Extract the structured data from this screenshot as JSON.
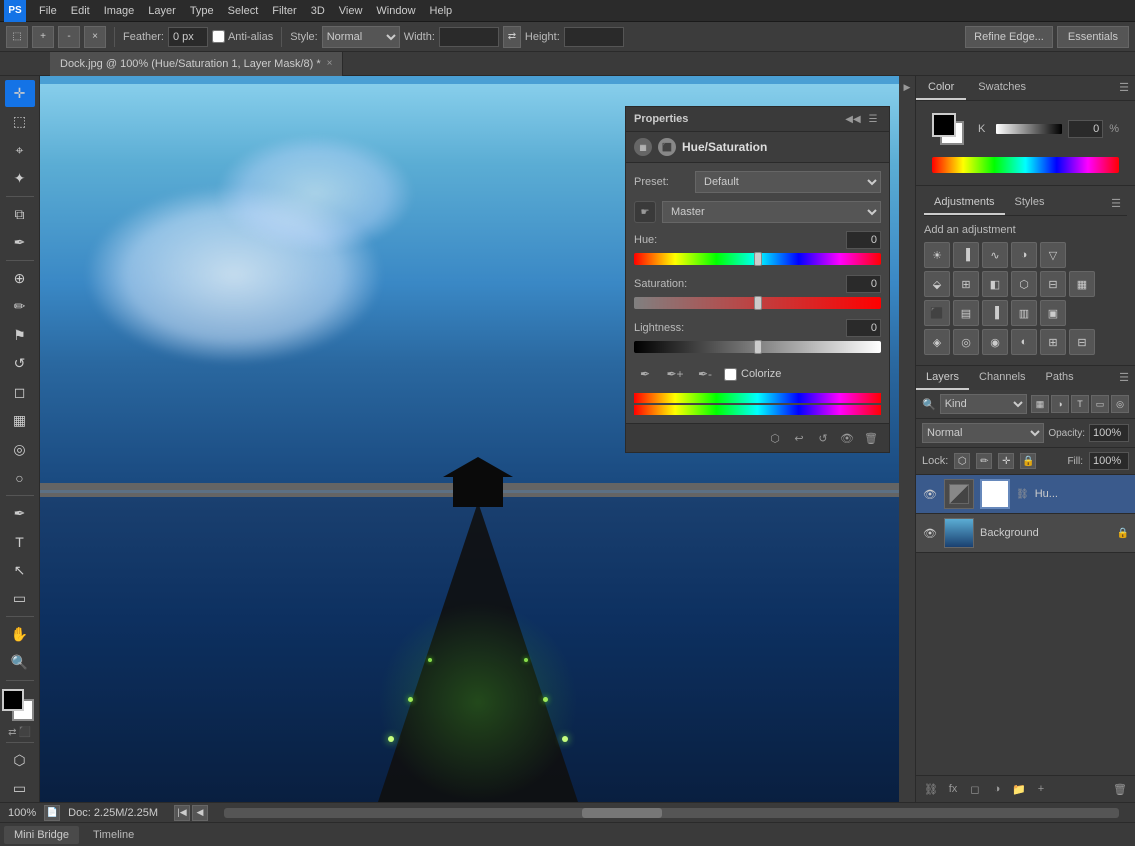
{
  "app": {
    "name": "Adobe Photoshop",
    "logo": "PS"
  },
  "menu": {
    "items": [
      "File",
      "Edit",
      "Image",
      "Layer",
      "Type",
      "Select",
      "Filter",
      "3D",
      "View",
      "Window",
      "Help"
    ]
  },
  "options_bar": {
    "feather_label": "Feather:",
    "feather_value": "0 px",
    "anti_alias_label": "Anti-alias",
    "style_label": "Style:",
    "style_value": "Normal",
    "width_label": "Width:",
    "height_label": "Height:",
    "refine_edge": "Refine Edge...",
    "essentials": "Essentials"
  },
  "document": {
    "tab_label": "Dock.jpg @ 100% (Hue/Saturation 1, Layer Mask/8) *",
    "close": "×"
  },
  "tools": [
    "▣",
    "▣",
    "⬚",
    "⬚",
    "✂",
    "🖊",
    "⌖",
    "⊗",
    "○",
    "◎",
    "✏",
    "🔍",
    "✒",
    "△",
    "⌂",
    "☉",
    "⚠",
    "🖐",
    "✋",
    "🔬",
    "∅"
  ],
  "properties_panel": {
    "title": "Properties",
    "sub_title": "Hue/Saturation",
    "preset_label": "Preset:",
    "preset_value": "Default",
    "channel_label": "Master",
    "hue_label": "Hue:",
    "hue_value": "0",
    "hue_thumb_pct": 50,
    "saturation_label": "Saturation:",
    "saturation_value": "0",
    "sat_thumb_pct": 50,
    "lightness_label": "Lightness:",
    "lightness_value": "0",
    "light_thumb_pct": 50,
    "colorize_label": "Colorize"
  },
  "color_panel": {
    "color_tab": "Color",
    "swatches_tab": "Swatches",
    "k_label": "K",
    "k_value": "0",
    "percent": "%"
  },
  "adjustments_panel": {
    "adjustments_tab": "Adjustments",
    "styles_tab": "Styles",
    "add_adjustment": "Add an adjustment"
  },
  "layers_panel": {
    "layers_tab": "Layers",
    "channels_tab": "Channels",
    "paths_tab": "Paths",
    "kind_label": "Kind",
    "blend_mode": "Normal",
    "opacity_label": "Opacity:",
    "opacity_value": "100%",
    "lock_label": "Lock:",
    "fill_label": "Fill:",
    "fill_value": "100%",
    "layers": [
      {
        "name": "Hu...",
        "visible": true,
        "has_mask": true,
        "selected": true,
        "type": "adjustment"
      },
      {
        "name": "Background",
        "visible": true,
        "has_mask": false,
        "selected": false,
        "type": "image",
        "locked": true
      }
    ]
  },
  "status_bar": {
    "zoom": "100%",
    "doc_size": "Doc: 2.25M/2.25M"
  },
  "bottom_tabs": {
    "mini_bridge": "Mini Bridge",
    "timeline": "Timeline"
  }
}
